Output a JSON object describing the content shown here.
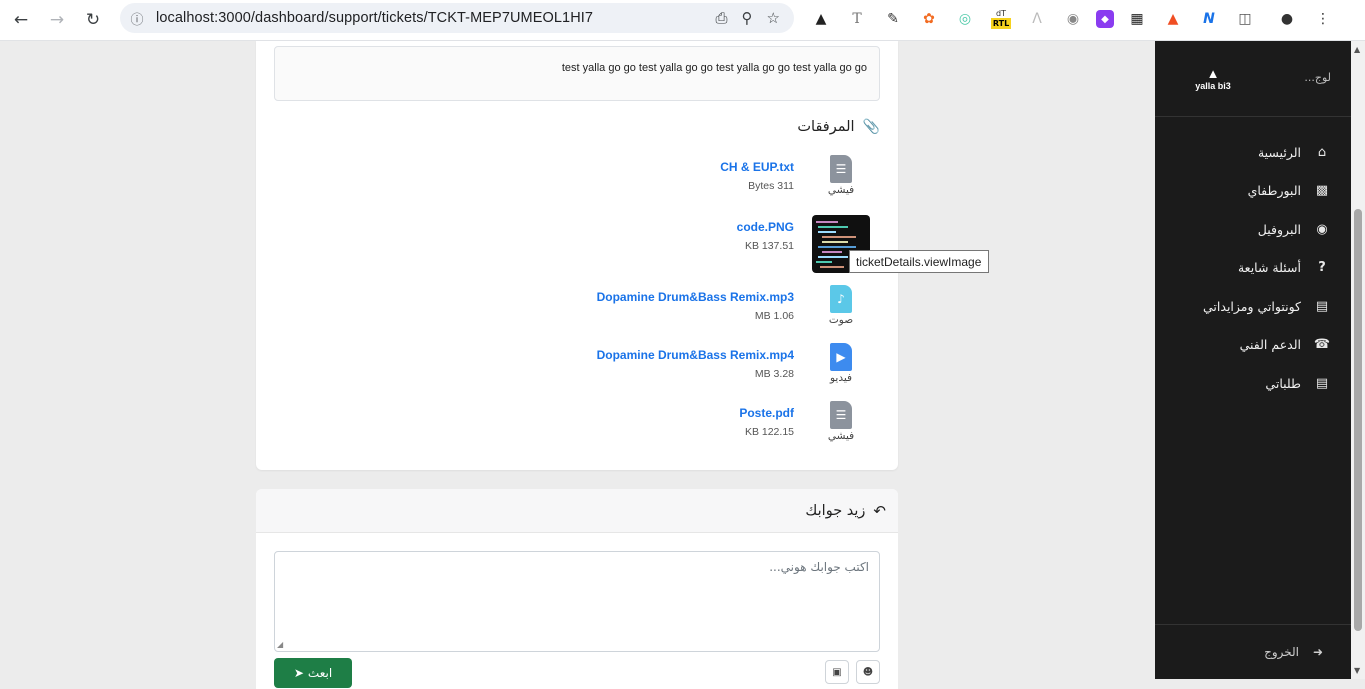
{
  "browser": {
    "url": "localhost:3000/dashboard/support/tickets/TCKT-MEP7UMEOL1HI7",
    "rtl_badge": "RTL",
    "rtl_badge_top": "dT"
  },
  "sidebar": {
    "brand": "yalla bi3",
    "close_label": "لوج...",
    "items": [
      {
        "label": "الرئيسية",
        "icon": "home-icon"
      },
      {
        "label": "البورطفاي",
        "icon": "wallet-icon"
      },
      {
        "label": "البروفيل",
        "icon": "user-circle-icon"
      },
      {
        "label": "أسئلة شايعة",
        "icon": "question-icon"
      },
      {
        "label": "كونتواتي ومزايداتي",
        "icon": "images-icon"
      },
      {
        "label": "الدعم الفني",
        "icon": "headset-icon"
      },
      {
        "label": "طلباتي",
        "icon": "clipboard-icon"
      }
    ],
    "logout": "الخروج"
  },
  "ticket": {
    "description": "test yalla go go test yalla go go test yalla go go test yalla go go",
    "attachments_title": "المرفقات",
    "attachments": [
      {
        "name": "CH & EUP.txt",
        "size": "Bytes 311",
        "type_label": "فيشي",
        "kind": "document",
        "color": "#8c939d"
      },
      {
        "name": "code.PNG",
        "size": "KB 137.51",
        "type_label": "",
        "kind": "image",
        "color": "#101010"
      },
      {
        "name": "Dopamine Drum&Bass Remix.mp3",
        "size": "MB 1.06",
        "type_label": "صوت",
        "kind": "audio",
        "color": "#5bc8e8"
      },
      {
        "name": "Dopamine Drum&Bass Remix.mp4",
        "size": "MB 3.28",
        "type_label": "فيديو",
        "kind": "video",
        "color": "#3d8bef"
      },
      {
        "name": "Poste.pdf",
        "size": "KB 122.15",
        "type_label": "فيشي",
        "kind": "document",
        "color": "#8c939d"
      }
    ],
    "tooltip": "ticketDetails.viewImage"
  },
  "reply": {
    "title": "زيد جوابك",
    "placeholder": "اكتب جوابك هوني...",
    "send_label": "ابعث"
  }
}
